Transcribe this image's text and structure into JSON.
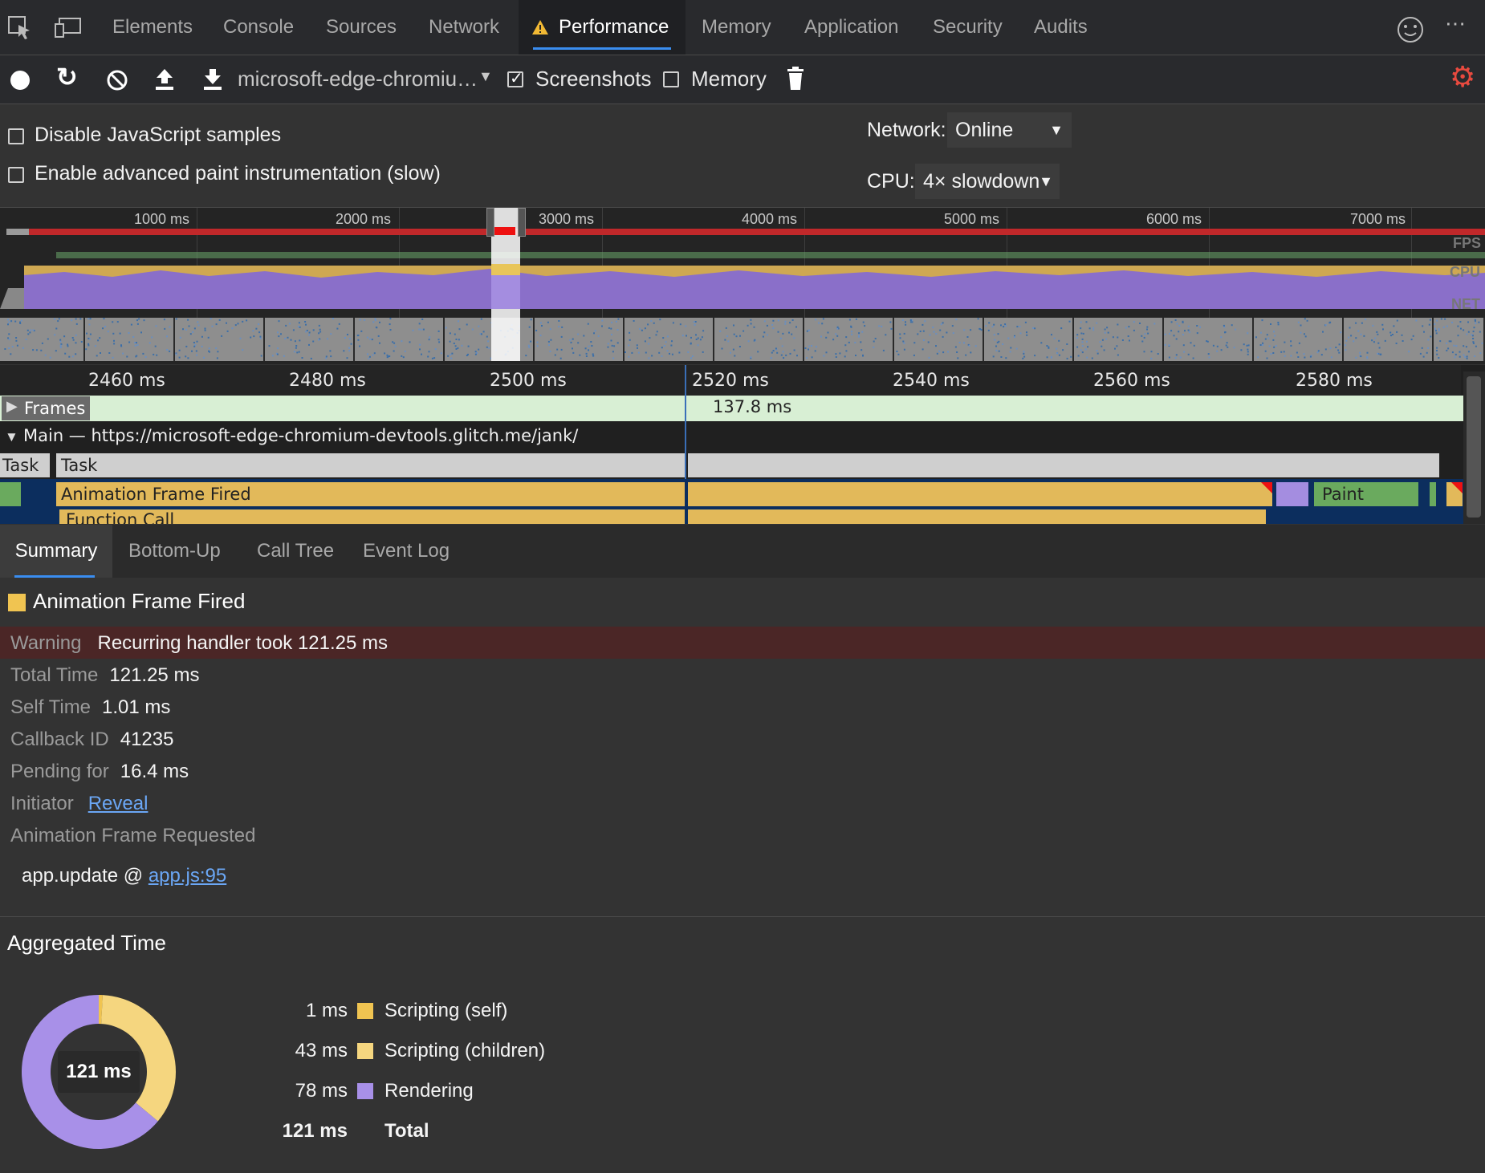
{
  "tabs": [
    {
      "label": "Elements"
    },
    {
      "label": "Console"
    },
    {
      "label": "Sources"
    },
    {
      "label": "Network"
    },
    {
      "label": "Performance"
    },
    {
      "label": "Memory"
    },
    {
      "label": "Application"
    },
    {
      "label": "Security"
    },
    {
      "label": "Audits"
    }
  ],
  "toolbar": {
    "recording_select": "microsoft-edge-chromiu…",
    "screenshots_label": "Screenshots",
    "screenshots_checked": true,
    "memory_label": "Memory",
    "memory_checked": false
  },
  "settings": {
    "disable_js_samples": "Disable JavaScript samples",
    "enable_paint": "Enable advanced paint instrumentation (slow)",
    "network_label": "Network:",
    "network_value": "Online",
    "cpu_label": "CPU:",
    "cpu_value": "4× slowdown"
  },
  "overview": {
    "ticks": [
      "1000 ms",
      "2000 ms",
      "3000 ms",
      "4000 ms",
      "5000 ms",
      "6000 ms",
      "7000 ms"
    ],
    "lanes": [
      "FPS",
      "CPU",
      "NET"
    ]
  },
  "flame": {
    "ticks": [
      "2460 ms",
      "2480 ms",
      "2500 ms",
      "2520 ms",
      "2540 ms",
      "2560 ms",
      "2580 ms"
    ],
    "frames_label": "Frames",
    "frame_duration": "137.8 ms",
    "main_label": "Main — https://microsoft-edge-chromium-devtools.glitch.me/jank/",
    "task_left": "Task",
    "task_right": "Task",
    "animation_frame": "Animation Frame Fired",
    "paint": "Paint",
    "function_call": "Function Call"
  },
  "details_tabs": [
    "Summary",
    "Bottom-Up",
    "Call Tree",
    "Event Log"
  ],
  "summary": {
    "title": "Animation Frame Fired",
    "title_color": "#f0c451",
    "warning_key": "Warning",
    "warning_value": "Recurring handler took 121.25 ms",
    "total_time_key": "Total Time",
    "total_time_value": "121.25 ms",
    "self_time_key": "Self Time",
    "self_time_value": "1.01 ms",
    "callback_id_key": "Callback ID",
    "callback_id_value": "41235",
    "pending_key": "Pending for",
    "pending_value": "16.4 ms",
    "initiator_key": "Initiator",
    "initiator_link": "Reveal",
    "requested_heading": "Animation Frame Requested",
    "stack_fn": "app.update @ ",
    "stack_link": "app.js:95"
  },
  "aggregated": {
    "heading": "Aggregated Time",
    "center": "121 ms",
    "items": [
      {
        "value": "1 ms",
        "label": "Scripting (self)",
        "color": "#f0c451",
        "ms": 1
      },
      {
        "value": "43 ms",
        "label": "Scripting (children)",
        "color": "#f5d67f",
        "ms": 43
      },
      {
        "value": "78 ms",
        "label": "Rendering",
        "color": "#a890e8",
        "ms": 78
      }
    ],
    "total_value": "121 ms",
    "total_label": "Total"
  }
}
